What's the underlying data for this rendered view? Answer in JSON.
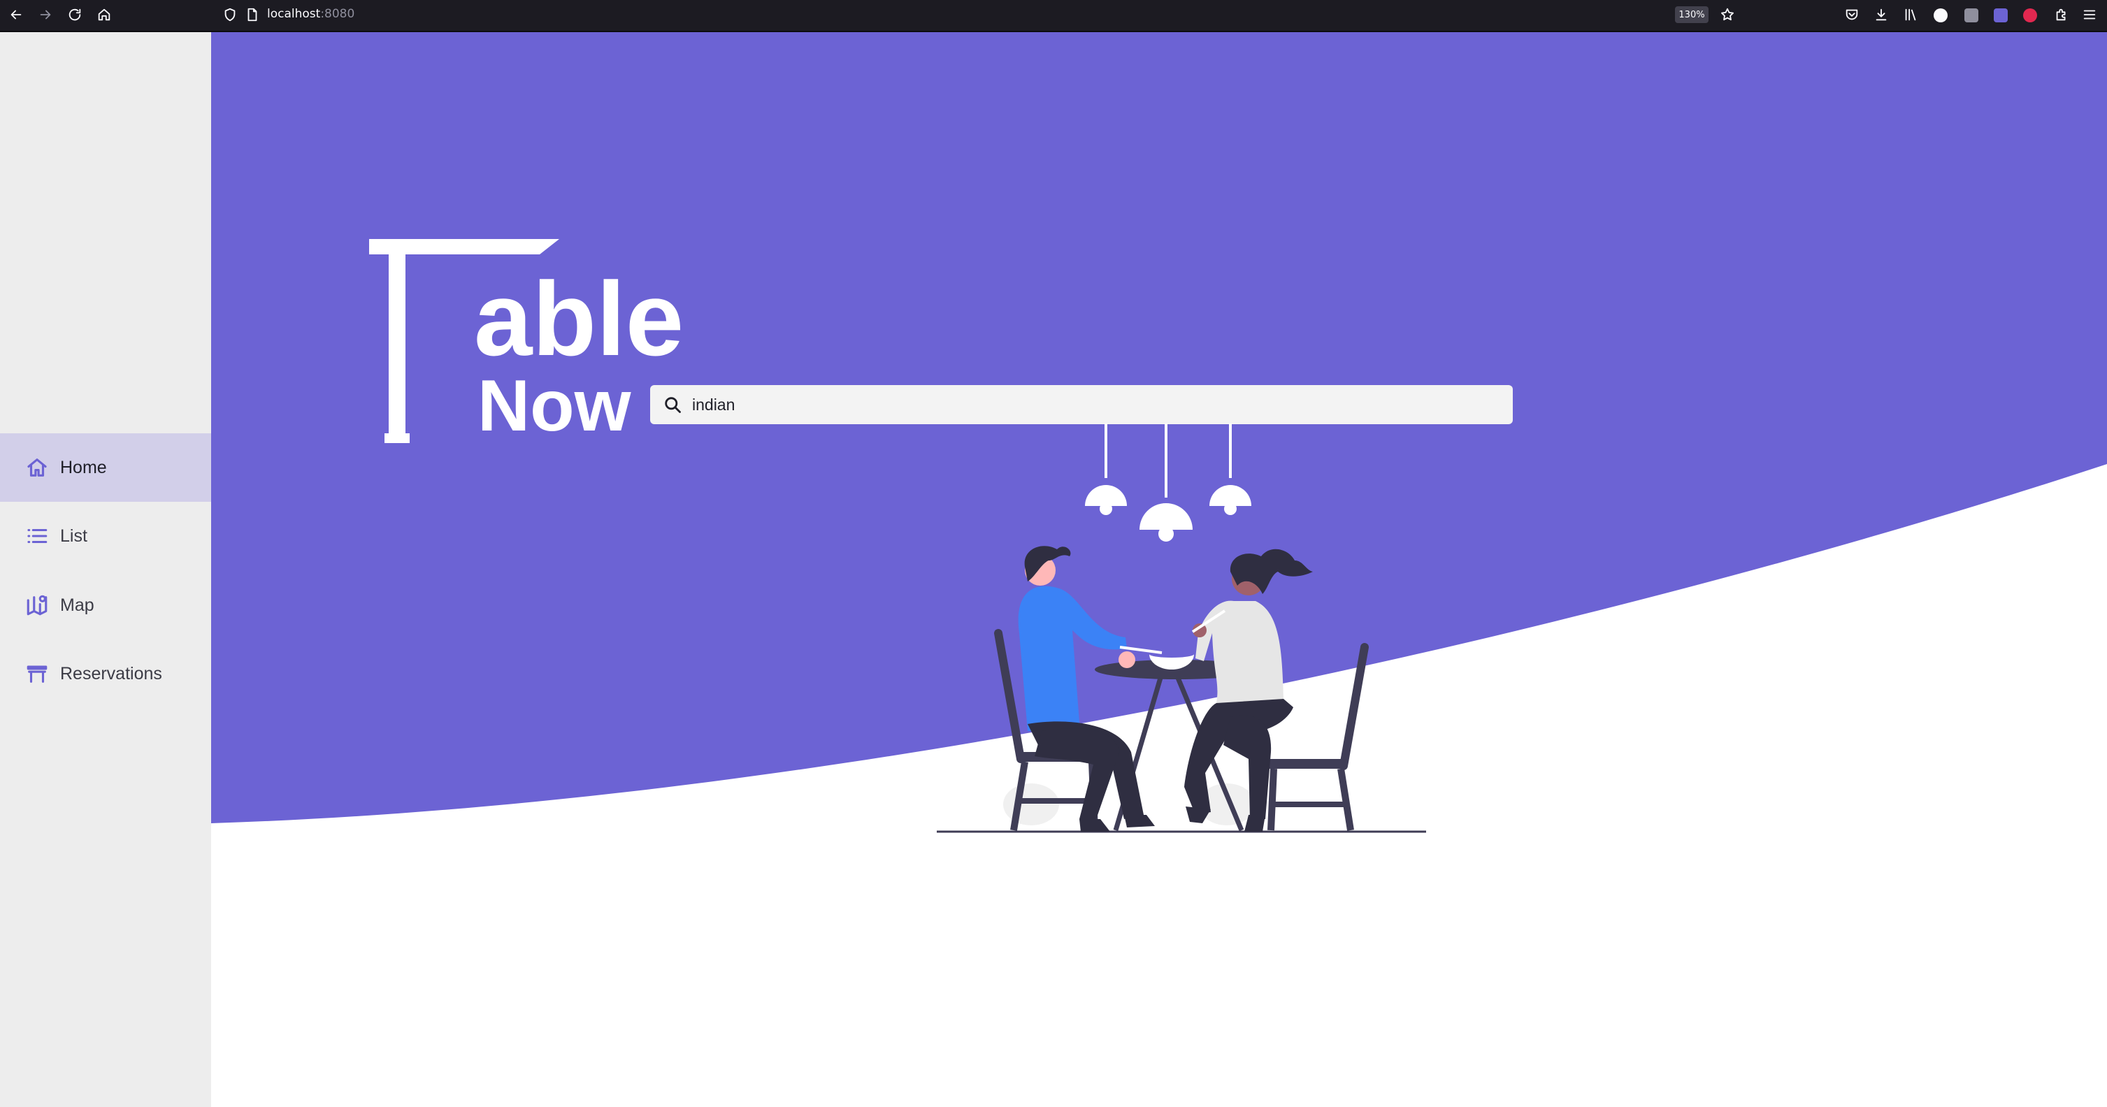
{
  "browser": {
    "url_host": "localhost",
    "url_port": ":8080",
    "zoom": "130%"
  },
  "brand": {
    "logo_part1": "able",
    "logo_part2": "Now"
  },
  "sidebar": {
    "items": [
      {
        "label": "Home",
        "icon": "home-icon",
        "active": true
      },
      {
        "label": "List",
        "icon": "list-icon",
        "active": false
      },
      {
        "label": "Map",
        "icon": "map-icon",
        "active": false
      },
      {
        "label": "Reservations",
        "icon": "table-icon",
        "active": false
      }
    ]
  },
  "search": {
    "value": "indian"
  },
  "colors": {
    "accent": "#6c63d4",
    "sidebar_bg": "#ededed",
    "active_bg": "#d2cfe9",
    "toolbar_bg": "#1c1b22"
  }
}
